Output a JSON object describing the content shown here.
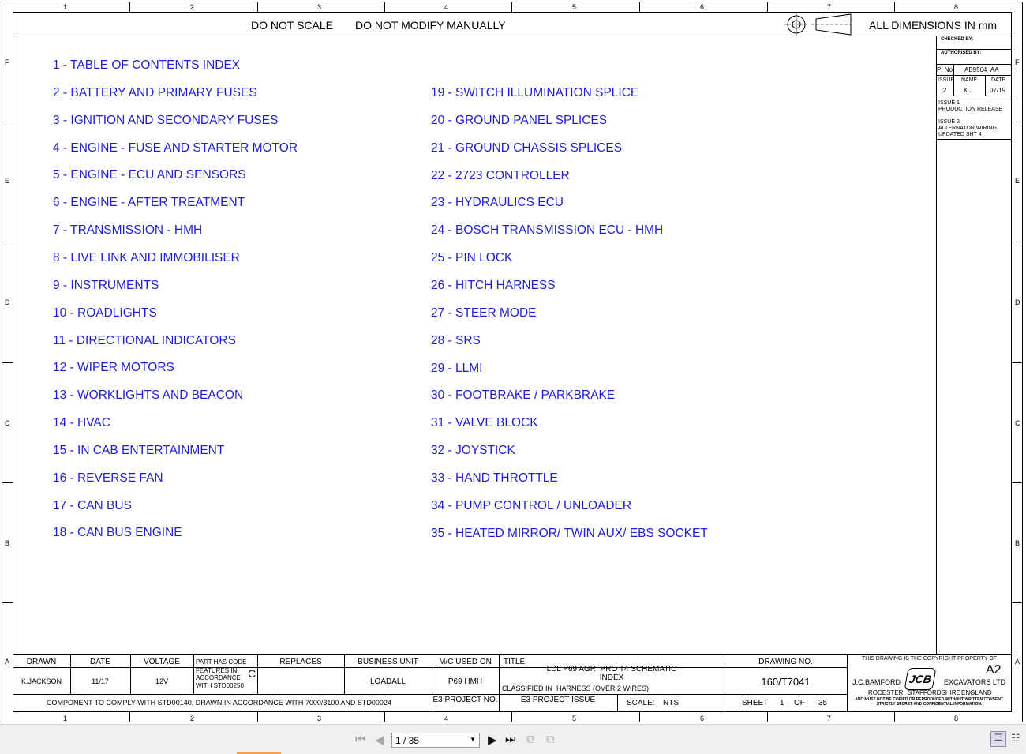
{
  "header": {
    "do_not_scale": "DO NOT SCALE",
    "do_not_modify": "DO NOT MODIFY MANUALLY",
    "dimensions": "ALL DIMENSIONS IN mm"
  },
  "zones": {
    "columns": [
      "1",
      "2",
      "3",
      "4",
      "5",
      "6",
      "7",
      "8"
    ],
    "rows": [
      "F",
      "E",
      "D",
      "C",
      "B",
      "A"
    ]
  },
  "toc_left": [
    "1 - TABLE OF CONTENTS INDEX",
    "2 - BATTERY AND PRIMARY FUSES",
    "3 - IGNITION AND SECONDARY FUSES",
    "4 - ENGINE - FUSE AND STARTER MOTOR",
    "5 - ENGINE - ECU AND SENSORS",
    "6 - ENGINE - AFTER TREATMENT",
    "7 - TRANSMISSION - HMH",
    "8 - LIVE LINK AND IMMOBILISER",
    "9 - INSTRUMENTS",
    "10 - ROADLIGHTS",
    "11 - DIRECTIONAL INDICATORS",
    "12 - WIPER MOTORS",
    "13 - WORKLIGHTS AND BEACON",
    "14 - HVAC",
    "15 - IN CAB ENTERTAINMENT",
    "16 - REVERSE FAN",
    "17 - CAN BUS",
    "18 - CAN BUS ENGINE"
  ],
  "toc_right": [
    "19 - SWITCH ILLUMINATION SPLICE",
    "20 - GROUND PANEL SPLICES",
    "21 - GROUND CHASSIS SPLICES",
    "22 - 2723 CONTROLLER",
    "23 - HYDRAULICS ECU",
    "24 - BOSCH TRANSMISSION ECU - HMH",
    "25 - PIN LOCK",
    "26 - HITCH HARNESS",
    "27 - STEER MODE",
    "28 - SRS",
    "29 - LLMI",
    "30 - FOOTBRAKE / PARKBRAKE",
    "31 - VALVE BLOCK",
    "32 - JOYSTICK",
    "33 - HAND THROTTLE",
    "34 - PUMP CONTROL / UNLOADER",
    "35 - HEATED MIRROR/ TWIN AUX/ EBS SOCKET"
  ],
  "revision": {
    "checked_by": "CHECKED BY:",
    "authorised_by": "AUTHORISED BY:",
    "pi_no_label": "PI No",
    "pi_no": "AB9564_AA",
    "issue_label": "ISSUE",
    "name_label": "NAME",
    "date_label": "DATE",
    "issue": "2",
    "name": "K.J",
    "date": "07/19",
    "note1_line1": "ISSUE 1",
    "note1_line2": "PRODUCTION RELEASE",
    "note2_line1": "ISSUE 2",
    "note2_line2": "ALTERNATOR WIRING",
    "note2_line3": "UPDATED SHT 4"
  },
  "title_block": {
    "drawn_label": "DRAWN",
    "drawn": "K.JACKSON",
    "date_label": "DATE",
    "date": "11/17",
    "voltage_label": "VOLTAGE",
    "voltage": "12V",
    "part_code_line1": "PART HAS CODE",
    "part_code_line2": "FEATURES IN",
    "part_code_line3": "ACCORDANCE",
    "part_code_line4": "WITH STD00250",
    "part_code_value": "C",
    "replaces_label": "REPLACES",
    "business_unit_label": "BUSINESS UNIT",
    "business_unit": "LOADALL",
    "mc_used_on_label": "M/C USED ON",
    "mc_used_on": "P69 HMH",
    "title_label": "TITLE",
    "title_line1": "LDL P69 AGRI PRO T4 SCHEMATIC",
    "title_line2": "INDEX",
    "classified_label": "CLASSIFIED IN",
    "classified": "HARNESS (OVER 2 WIRES)",
    "drawing_no_label": "DRAWING NO.",
    "drawing_no": "160/T7041",
    "comply_note": "COMPONENT TO COMPLY WITH STD00140, DRAWN IN ACCORDANCE WITH 7000/3100 AND STD00024",
    "e3_project_no_label": "E3 PROJECT NO.",
    "e3_project_issue_label": "E3 PROJECT ISSUE",
    "scale_label": "SCALE:",
    "scale": "NTS",
    "sheet_label": "SHEET",
    "sheet": "1",
    "of_label": "OF",
    "sheet_total": "35",
    "copyright": "THIS DRAWING IS THE COPYRIGHT PROPERTY OF",
    "size": "A2",
    "company_left": "J.C.BAMFORD",
    "company_right": "EXCAVATORS LTD",
    "logo_text": "JCB",
    "loc1": "ROCESTER",
    "loc2": "STAFFORDSHIRE",
    "loc3": "ENGLAND",
    "disclaimer_line1": "AND MUST NOT BE COPIED OR REPRODUCED WITHOUT WRITTEN CONSENT.",
    "disclaimer_line2": "STRICTLY SECRET AND CONFIDENTIAL INFORMATION."
  },
  "viewer": {
    "page_indicator": "1 / 35"
  }
}
